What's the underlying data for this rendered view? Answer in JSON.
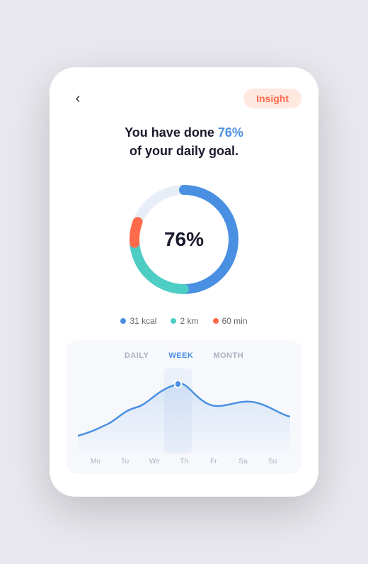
{
  "header": {
    "back_icon": "‹",
    "insight_label": "Insight"
  },
  "goal": {
    "text_before": "You have done ",
    "percentage": "76%",
    "text_after": " of your daily goal.",
    "percentage_display": "76%"
  },
  "donut": {
    "percentage": 76,
    "colors": {
      "kcal": "#4A90E2",
      "km": "#4ECDC4",
      "min": "#FF6B4A",
      "track": "#E8EEF8"
    }
  },
  "legend": [
    {
      "label": "31 kcal",
      "color": "#4A90E2"
    },
    {
      "label": "2 km",
      "color": "#4ECDC4"
    },
    {
      "label": "60 min",
      "color": "#FF6B4A"
    }
  ],
  "chart": {
    "tabs": [
      "DAILY",
      "WEEK",
      "MONTH"
    ],
    "active_tab": "WEEK",
    "labels": [
      "Mo",
      "Tu",
      "We",
      "Th",
      "Fr",
      "Sa",
      "Su"
    ],
    "highlight_column": "Th"
  }
}
